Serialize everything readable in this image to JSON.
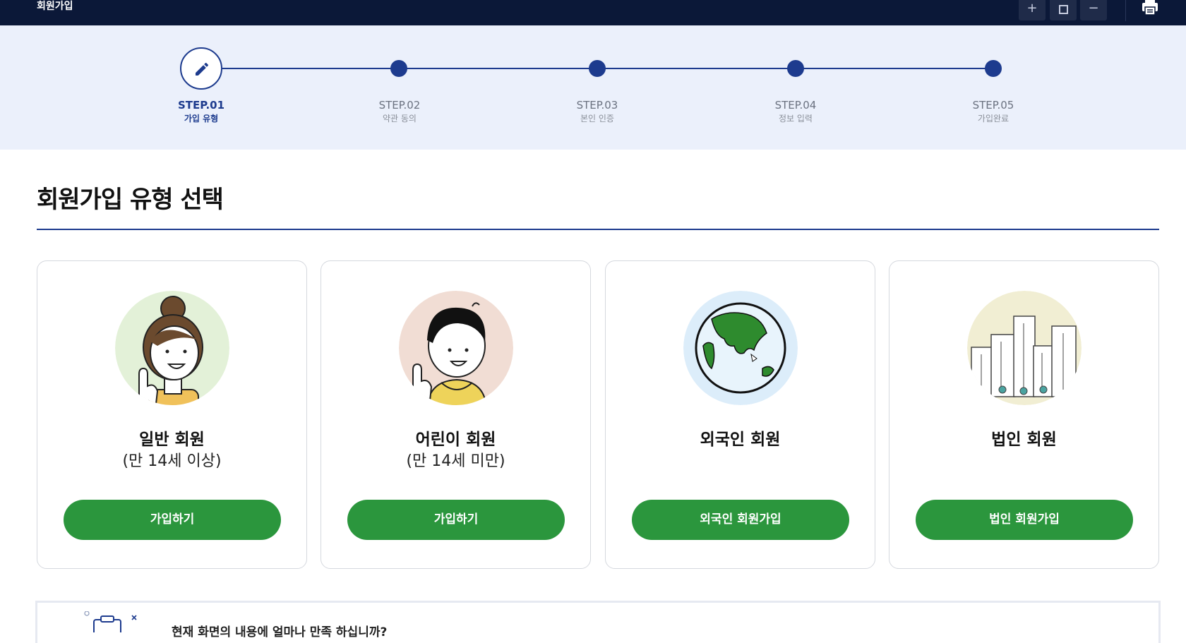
{
  "topbar": {
    "title": "회원가입",
    "controls": {
      "zoom_in_icon": "plus-icon",
      "fullscreen_icon": "square-icon",
      "zoom_out_icon": "minus-icon",
      "print_icon": "printer-icon"
    },
    "bg_color": "#0b1838"
  },
  "stepper": {
    "steps": [
      {
        "num": "STEP.01",
        "name": "가입 유형",
        "active": true
      },
      {
        "num": "STEP.02",
        "name": "약관 동의",
        "active": false
      },
      {
        "num": "STEP.03",
        "name": "본인 인증",
        "active": false
      },
      {
        "num": "STEP.04",
        "name": "정보 입력",
        "active": false
      },
      {
        "num": "STEP.05",
        "name": "가입완료",
        "active": false
      }
    ],
    "accent": "#1d3b8e"
  },
  "main": {
    "heading": "회원가입 유형 선택",
    "cards": [
      {
        "title": "일반 회원",
        "subtitle": "(만 14세 이상)",
        "button": "가입하기",
        "icon": "woman-avatar-icon"
      },
      {
        "title": "어린이 회원",
        "subtitle": "(만 14세 미만)",
        "button": "가입하기",
        "icon": "child-avatar-icon"
      },
      {
        "title": "외국인 회원",
        "subtitle": "",
        "button": "외국인 회원가입",
        "icon": "globe-icon"
      },
      {
        "title": "법인 회원",
        "subtitle": "",
        "button": "법인 회원가입",
        "icon": "buildings-icon"
      }
    ],
    "button_color": "#2b963d"
  },
  "survey": {
    "question": "현재 화면의 내용에 얼마나 만족 하십니까?"
  }
}
